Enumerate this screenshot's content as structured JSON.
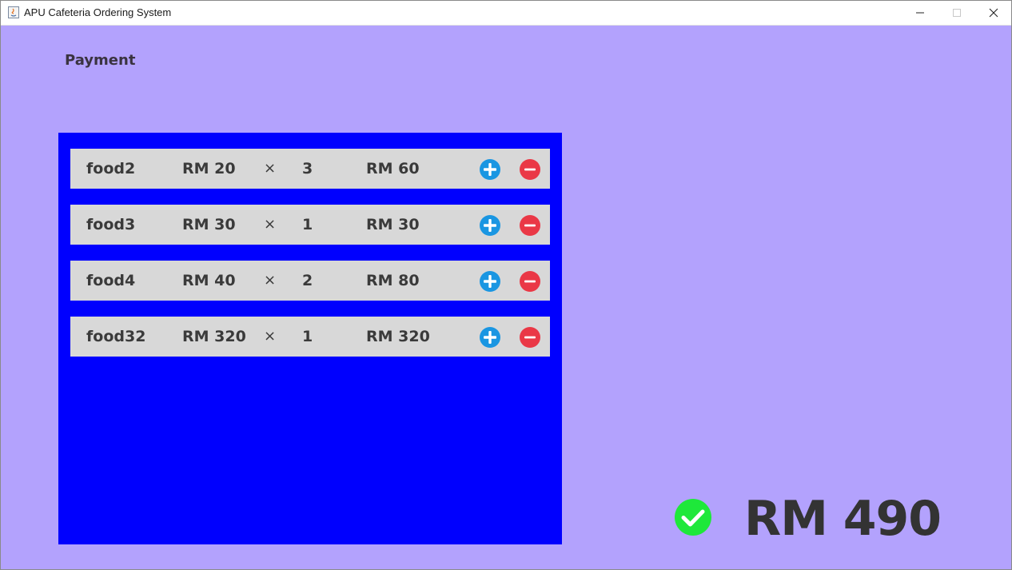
{
  "window": {
    "title": "APU Cafeteria Ordering System"
  },
  "page": {
    "title": "Payment"
  },
  "cart": {
    "items": [
      {
        "name": "food2",
        "price": "RM 20",
        "times": "×",
        "qty": "3",
        "subtotal": "RM 60"
      },
      {
        "name": "food3",
        "price": "RM 30",
        "times": "×",
        "qty": "1",
        "subtotal": "RM 30"
      },
      {
        "name": "food4",
        "price": "RM 40",
        "times": "×",
        "qty": "2",
        "subtotal": "RM 80"
      },
      {
        "name": "food32",
        "price": "RM 320",
        "times": "×",
        "qty": "1",
        "subtotal": "RM 320"
      }
    ]
  },
  "summary": {
    "total": "RM 490"
  },
  "icons": {
    "plus": "plus-circle-icon",
    "minus": "minus-circle-icon",
    "confirm": "check-circle-icon"
  },
  "colors": {
    "background": "#b3a2fd",
    "panel": "#0000fe",
    "row": "#d8d8d8",
    "plus": "#1a96e2",
    "minus": "#ea3846",
    "confirm": "#1ee83a",
    "text": "#333333"
  }
}
